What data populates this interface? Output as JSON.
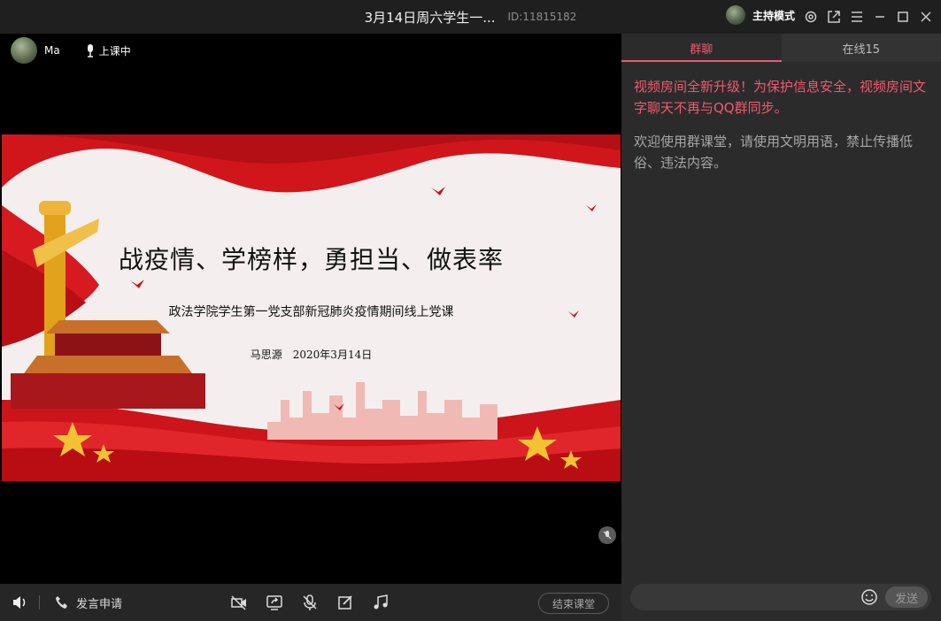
{
  "window": {
    "title": "3月14日周六学生一...",
    "room_id": "ID:11815182",
    "host_mode_label": "主持模式",
    "icons": [
      "settings-icon",
      "share-icon",
      "menu-icon",
      "minimize-icon",
      "maximize-icon",
      "close-icon"
    ]
  },
  "video": {
    "presenter_name": "Ma",
    "status": "上课中",
    "slide": {
      "title": "战疫情、学榜样，勇担当、做表率",
      "subtitle": "政法学院学生第一党支部新冠肺炎疫情期间线上党课",
      "author": "马思源　2020年3月14日"
    }
  },
  "toolbar": {
    "apply_label": "发言申请",
    "end_class_label": "结束课堂",
    "icons": [
      "speaker-icon",
      "phone-icon",
      "camera-off-icon",
      "screen-share-icon",
      "mic-off-icon",
      "edit-icon",
      "music-icon"
    ]
  },
  "panel": {
    "tabs": [
      {
        "label": "群聊",
        "active": true
      },
      {
        "label": "在线15",
        "active": false
      }
    ],
    "messages": [
      {
        "text": "视频房间全新升级！为保护信息安全，视频房间文字聊天不再与QQ群同步。",
        "color": "#ef5a6e"
      },
      {
        "text": "欢迎使用群课堂，请使用文明用语，禁止传播低俗、违法内容。",
        "color": "#a7a7a7"
      }
    ],
    "input": {
      "value": "",
      "placeholder": ""
    },
    "send_label": "发送"
  },
  "colors": {
    "accent": "#ef5a6e",
    "panel_bg": "#2b2b2b",
    "titlebar_bg": "#1f1f1f"
  }
}
